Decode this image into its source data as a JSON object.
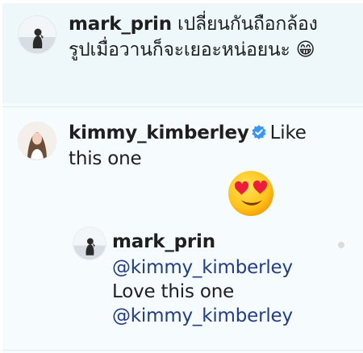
{
  "comment1": {
    "username": "mark_prin",
    "line1": "เปลี่ยนกันถือกล้อง",
    "line2": "รูปเมื่อวานก็จะเยอะหน่อยนะ",
    "emoji": "😁"
  },
  "comment2": {
    "username": "kimmy_kimberley",
    "text_part1": "Like",
    "text_part2": "this one",
    "emoji": "😍"
  },
  "reply": {
    "username": "mark_prin",
    "mention1": "@kimmy_kimberley",
    "text": "Love this one",
    "mention2": "@kimmy_kimberley"
  },
  "colors": {
    "mention": "#233c86",
    "verified": "#3897f0"
  }
}
